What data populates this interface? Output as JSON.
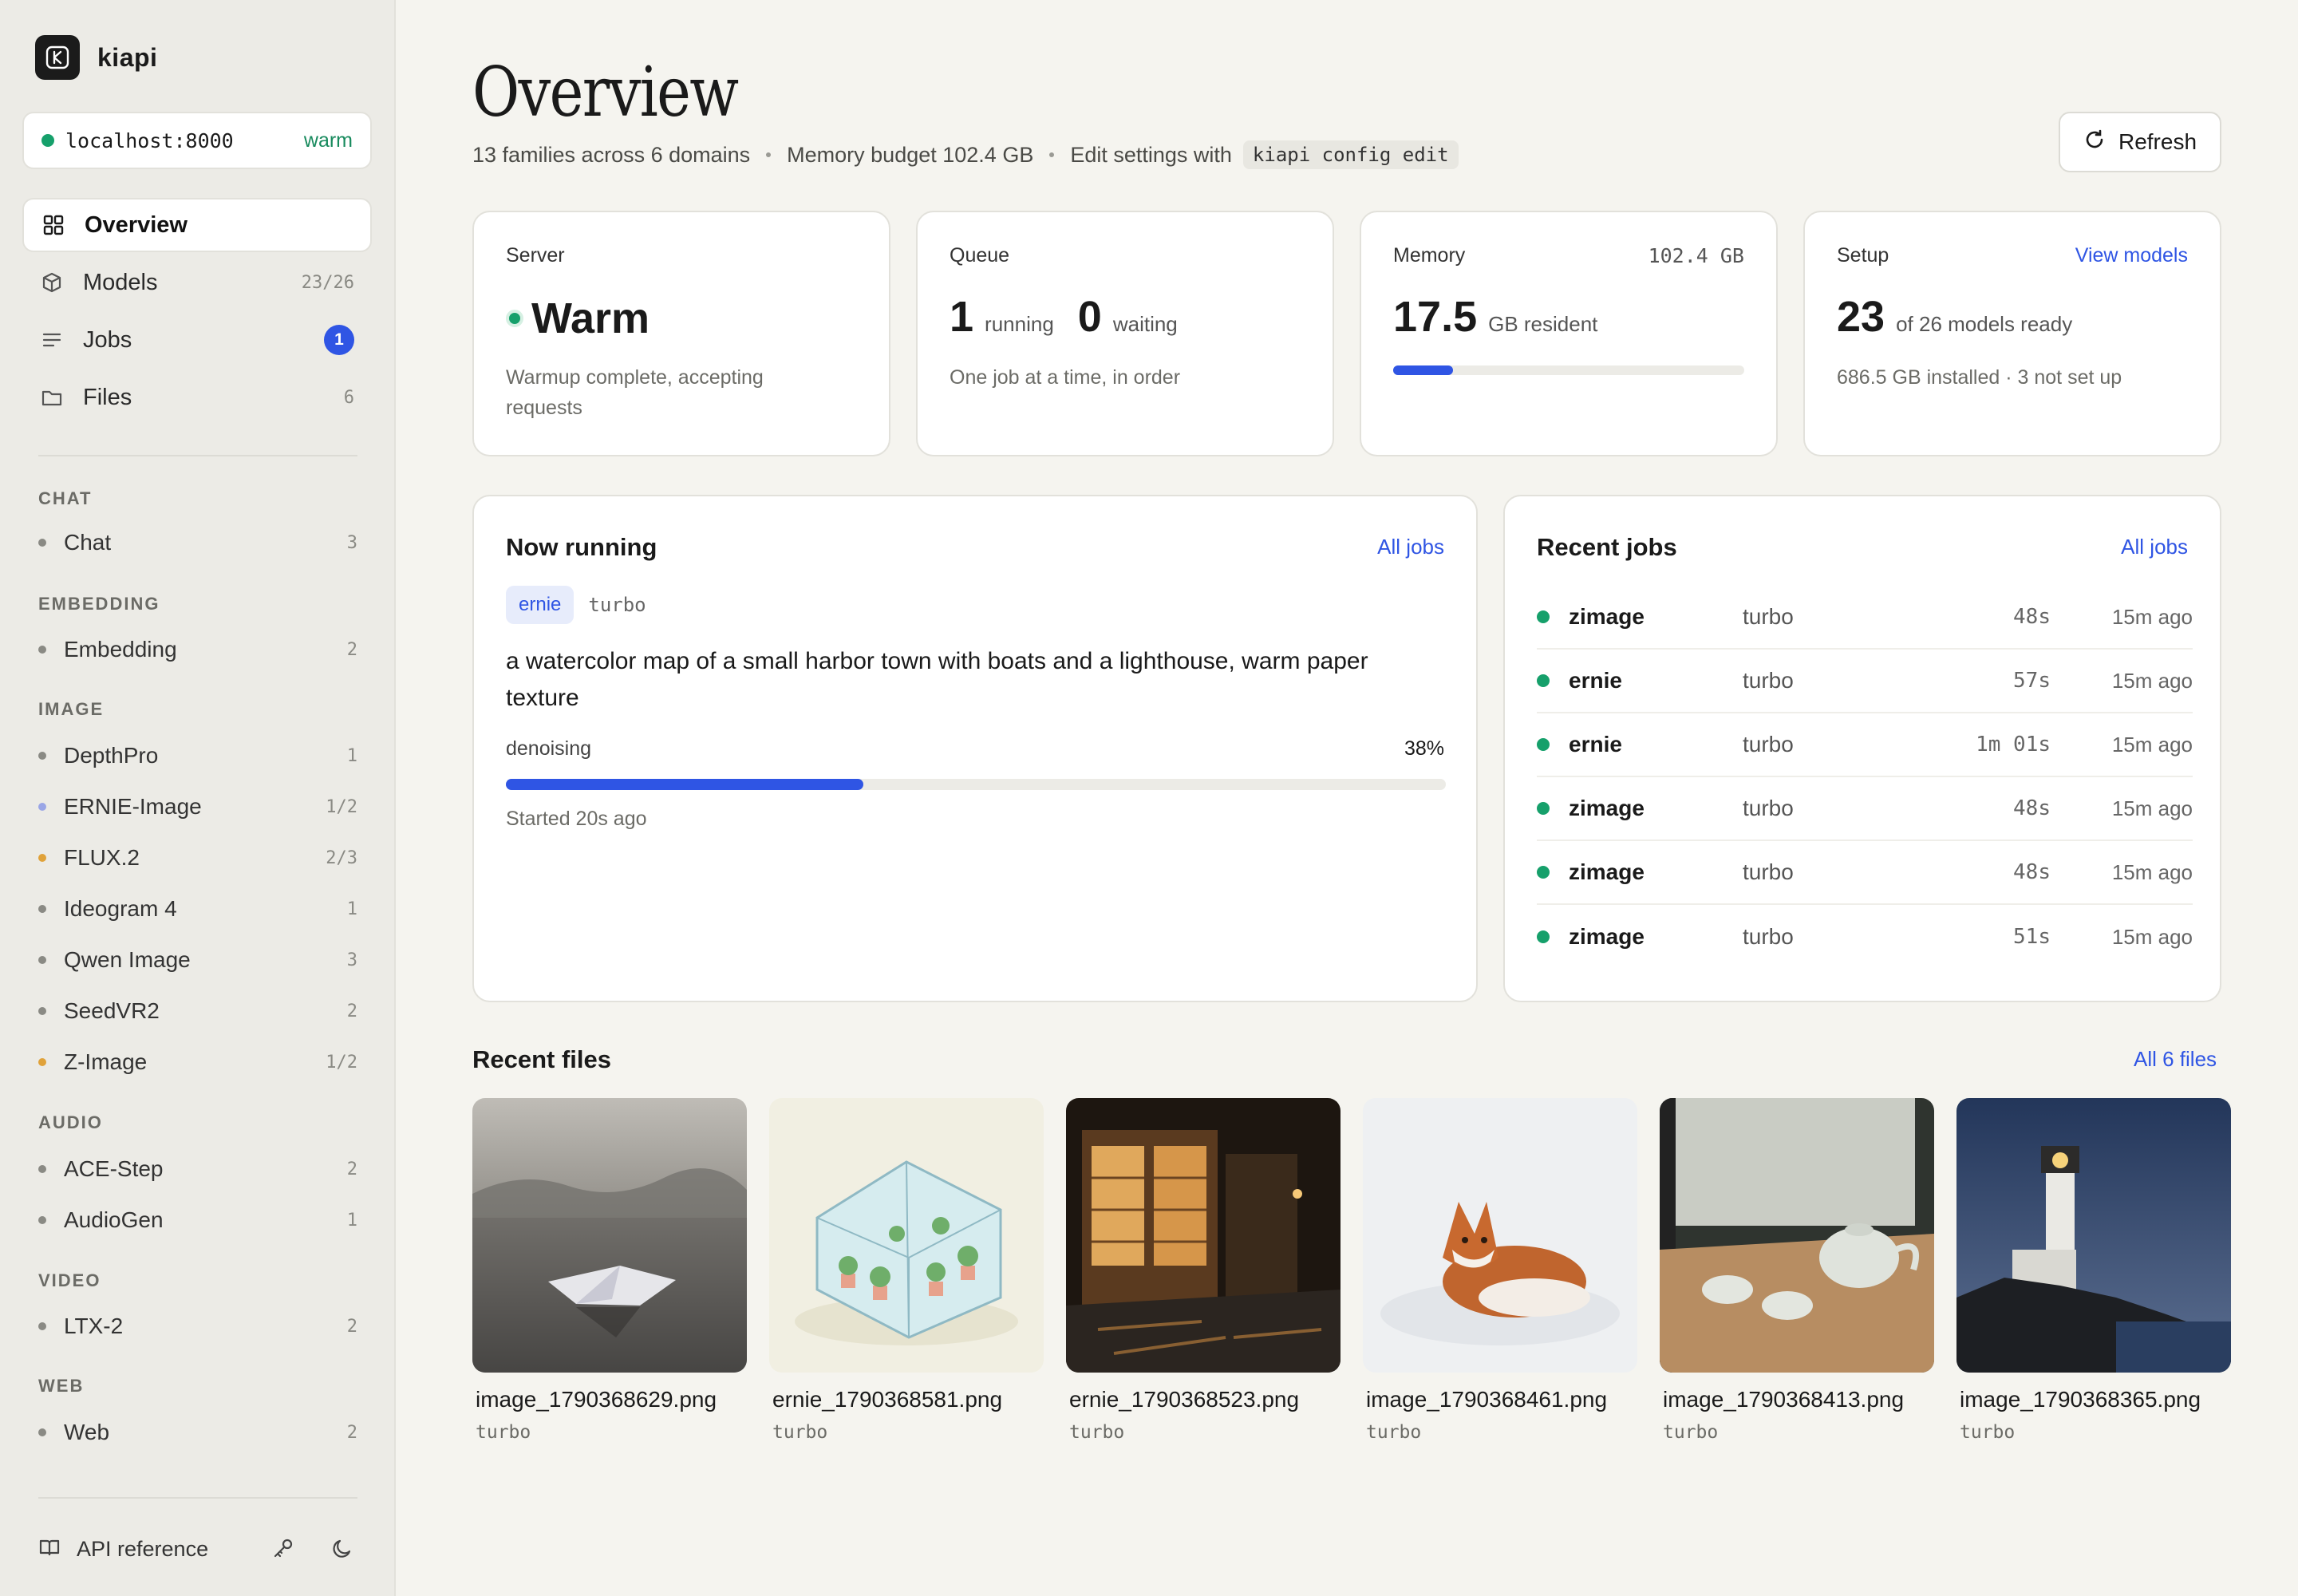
{
  "brand": {
    "name": "kiapi",
    "logo_letter": "K"
  },
  "server": {
    "host": "localhost:8000",
    "state": "warm"
  },
  "nav": [
    {
      "label": "Overview",
      "icon": "grid-icon",
      "active": true
    },
    {
      "label": "Models",
      "icon": "cube-icon",
      "count": "23/26"
    },
    {
      "label": "Jobs",
      "icon": "list-icon",
      "badge": "1"
    },
    {
      "label": "Files",
      "icon": "folder-icon",
      "count": "6"
    }
  ],
  "families": [
    {
      "section": "CHAT",
      "items": [
        {
          "label": "Chat",
          "count": "3",
          "color": "#8a8a84"
        }
      ]
    },
    {
      "section": "EMBEDDING",
      "items": [
        {
          "label": "Embedding",
          "count": "2",
          "color": "#8a8a84"
        }
      ]
    },
    {
      "section": "IMAGE",
      "items": [
        {
          "label": "DepthPro",
          "count": "1",
          "color": "#8a8a84"
        },
        {
          "label": "ERNIE-Image",
          "count": "1/2",
          "color": "#9aa6e6"
        },
        {
          "label": "FLUX.2",
          "count": "2/3",
          "color": "#e0a23a"
        },
        {
          "label": "Ideogram 4",
          "count": "1",
          "color": "#8a8a84"
        },
        {
          "label": "Qwen Image",
          "count": "3",
          "color": "#8a8a84"
        },
        {
          "label": "SeedVR2",
          "count": "2",
          "color": "#8a8a84"
        },
        {
          "label": "Z-Image",
          "count": "1/2",
          "color": "#e0a23a"
        }
      ]
    },
    {
      "section": "AUDIO",
      "items": [
        {
          "label": "ACE-Step",
          "count": "2",
          "color": "#8a8a84"
        },
        {
          "label": "AudioGen",
          "count": "1",
          "color": "#8a8a84"
        }
      ]
    },
    {
      "section": "VIDEO",
      "items": [
        {
          "label": "LTX-2",
          "count": "2",
          "color": "#8a8a84"
        }
      ]
    },
    {
      "section": "WEB",
      "items": [
        {
          "label": "Web",
          "count": "2",
          "color": "#8a8a84"
        }
      ]
    }
  ],
  "footer": {
    "api_label": "API reference"
  },
  "header": {
    "title": "Overview",
    "families_text": "13 families across 6 domains",
    "memory_text": "Memory budget 102.4 GB",
    "settings_text": "Edit settings with",
    "settings_cmd": "kiapi config edit",
    "refresh_label": "Refresh"
  },
  "stats": {
    "server": {
      "title": "Server",
      "value": "Warm",
      "note": "Warmup complete, accepting requests"
    },
    "queue": {
      "title": "Queue",
      "running": "1",
      "running_label": "running",
      "waiting": "0",
      "waiting_label": "waiting",
      "note": "One job at a time, in order"
    },
    "memory": {
      "title": "Memory",
      "total": "102.4 GB",
      "value": "17.5",
      "unit": "GB resident",
      "fraction": 0.17
    },
    "setup": {
      "title": "Setup",
      "link": "View models",
      "value": "23",
      "label": "of 26 models ready",
      "note": "686.5 GB installed · 3 not set up"
    }
  },
  "now_running": {
    "title": "Now running",
    "link": "All jobs",
    "model": "ernie",
    "mode": "turbo",
    "prompt": "a watercolor map of a small harbor town with boats and a lighthouse, warm paper texture",
    "stage": "denoising",
    "percent_text": "38%",
    "progress": 0.38,
    "started": "Started 20s ago"
  },
  "recent_jobs": {
    "title": "Recent jobs",
    "link": "All jobs",
    "rows": [
      {
        "name": "zimage",
        "mode": "turbo",
        "duration": "48s",
        "ago": "15m ago"
      },
      {
        "name": "ernie",
        "mode": "turbo",
        "duration": "57s",
        "ago": "15m ago"
      },
      {
        "name": "ernie",
        "mode": "turbo",
        "duration": "1m 01s",
        "ago": "15m ago"
      },
      {
        "name": "zimage",
        "mode": "turbo",
        "duration": "48s",
        "ago": "15m ago"
      },
      {
        "name": "zimage",
        "mode": "turbo",
        "duration": "48s",
        "ago": "15m ago"
      },
      {
        "name": "zimage",
        "mode": "turbo",
        "duration": "51s",
        "ago": "15m ago"
      }
    ]
  },
  "recent_files": {
    "title": "Recent files",
    "link": "All 6 files",
    "files": [
      {
        "name": "image_1790368629.png",
        "model": "turbo"
      },
      {
        "name": "ernie_1790368581.png",
        "model": "turbo"
      },
      {
        "name": "ernie_1790368523.png",
        "model": "turbo"
      },
      {
        "name": "image_1790368461.png",
        "model": "turbo"
      },
      {
        "name": "image_1790368413.png",
        "model": "turbo"
      },
      {
        "name": "image_1790368365.png",
        "model": "turbo"
      }
    ]
  },
  "colors": {
    "accent": "#2f55e4",
    "ok": "#16a06b",
    "warn": "#e0a23a"
  }
}
